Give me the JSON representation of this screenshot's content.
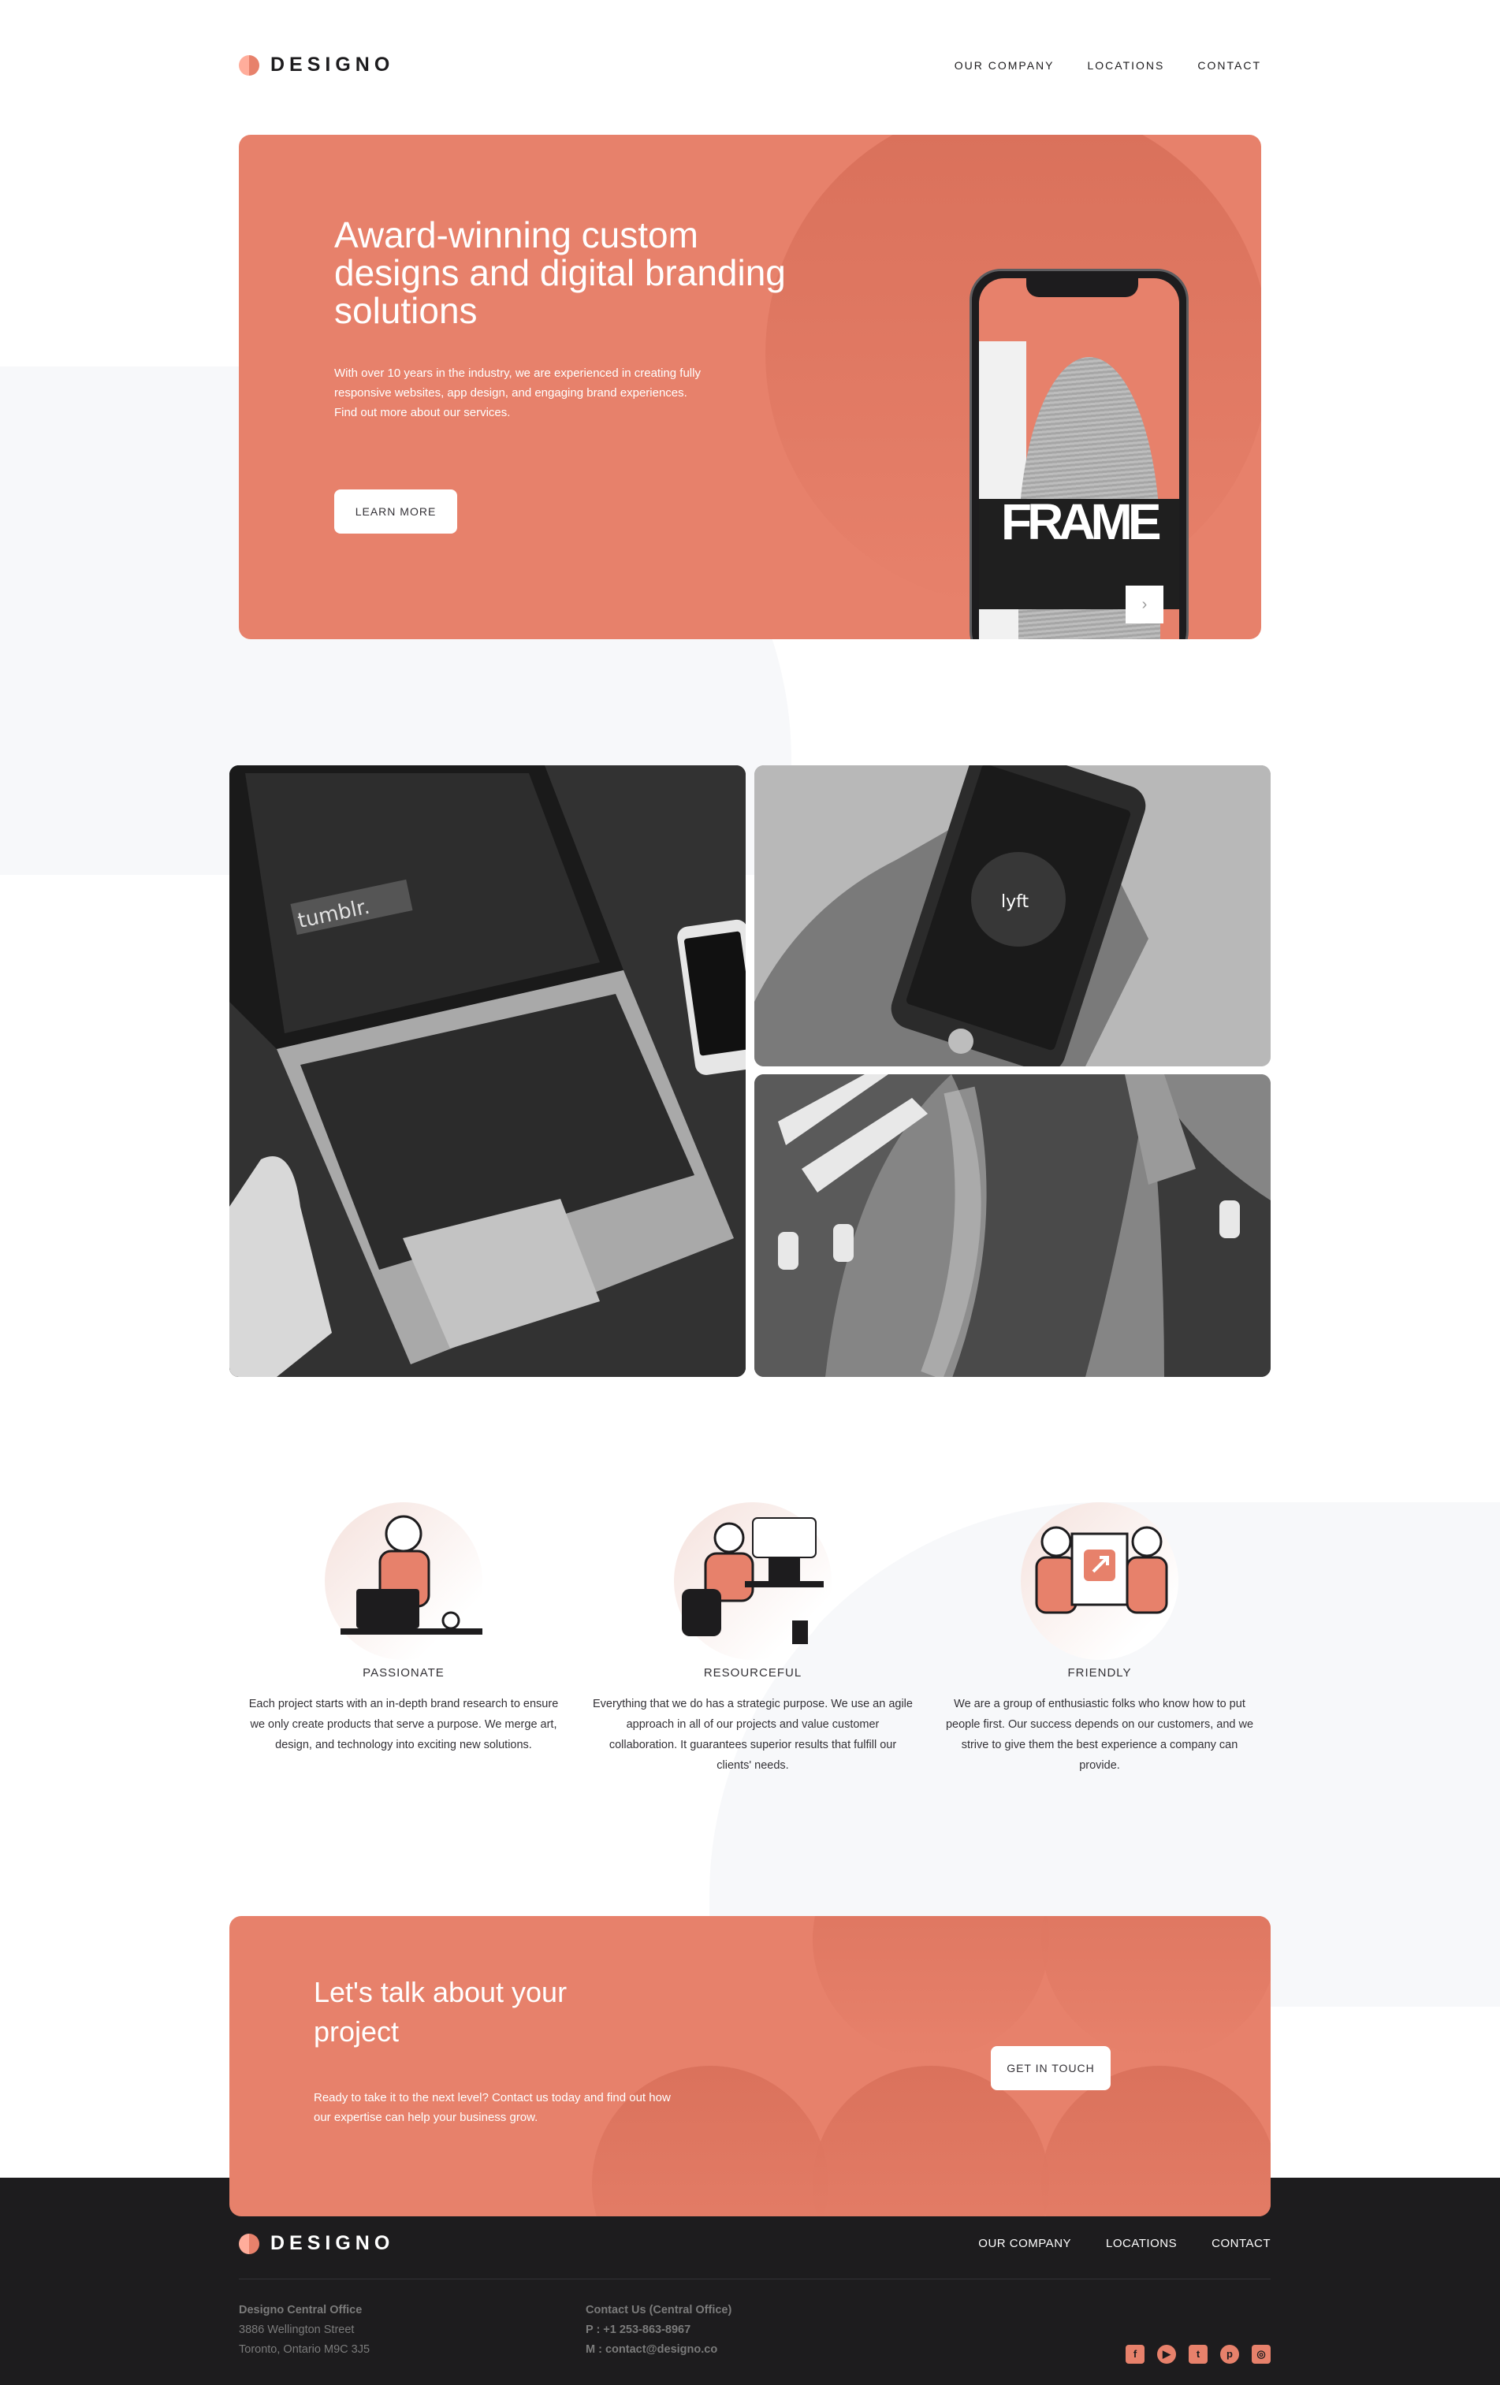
{
  "brand": {
    "name": "DESIGNO",
    "accent": "#e7816b",
    "dark": "#1d1c1e"
  },
  "nav": {
    "items": [
      {
        "label": "OUR COMPANY"
      },
      {
        "label": "LOCATIONS"
      },
      {
        "label": "CONTACT"
      }
    ]
  },
  "hero": {
    "title": "Award-winning custom designs and digital branding solutions",
    "description": "With over 10 years in the industry, we are experienced in creating fully responsive websites, app design, and engaging brand experiences. Find out more about our services.",
    "button_label": "LEARN MORE",
    "phone_screen_text": "FRAME",
    "phone_next_arrow": "›"
  },
  "gallery": {
    "tiles": [
      {
        "icon": "laptop-photo"
      },
      {
        "icon": "phone-lyft-photo"
      },
      {
        "icon": "abstract-graphic-photo"
      }
    ],
    "phone_app_logo": "lyft",
    "laptop_screen_text": "tumblr."
  },
  "features": [
    {
      "title": "PASSIONATE",
      "description": "Each project starts with an in-depth brand research to ensure we only create products that serve a purpose. We merge art, design, and technology into exciting new solutions.",
      "icon": "passionate-illustration"
    },
    {
      "title": "RESOURCEFUL",
      "description": "Everything that we do has a strategic purpose. We use an agile approach in all of our projects and value customer collaboration. It guarantees superior results that fulfill our clients' needs.",
      "icon": "resourceful-illustration"
    },
    {
      "title": "FRIENDLY",
      "description": "We are a group of enthusiastic folks who know how to put people first. Our success depends on our customers, and we strive to give them the best experience a company can provide.",
      "icon": "friendly-illustration"
    }
  ],
  "cta": {
    "title": "Let's talk about your project",
    "description": "Ready to take it to the next level? Contact us today and find out how our expertise can help your business grow.",
    "button_label": "GET IN TOUCH"
  },
  "footer": {
    "brand": "DESIGNO",
    "nav": [
      {
        "label": "OUR COMPANY"
      },
      {
        "label": "LOCATIONS"
      },
      {
        "label": "CONTACT"
      }
    ],
    "office": {
      "heading": "Designo Central Office",
      "street": "3886 Wellington Street",
      "city": "Toronto, Ontario M9C 3J5"
    },
    "contact": {
      "heading": "Contact Us (Central Office)",
      "phone": "P : +1 253-863-8967",
      "email": "M : contact@designo.co"
    },
    "socials": [
      {
        "icon": "facebook-icon",
        "glyph": "f"
      },
      {
        "icon": "youtube-icon",
        "glyph": "▶"
      },
      {
        "icon": "twitter-icon",
        "glyph": "t"
      },
      {
        "icon": "pinterest-icon",
        "glyph": "p"
      },
      {
        "icon": "instagram-icon",
        "glyph": "◎"
      }
    ]
  }
}
